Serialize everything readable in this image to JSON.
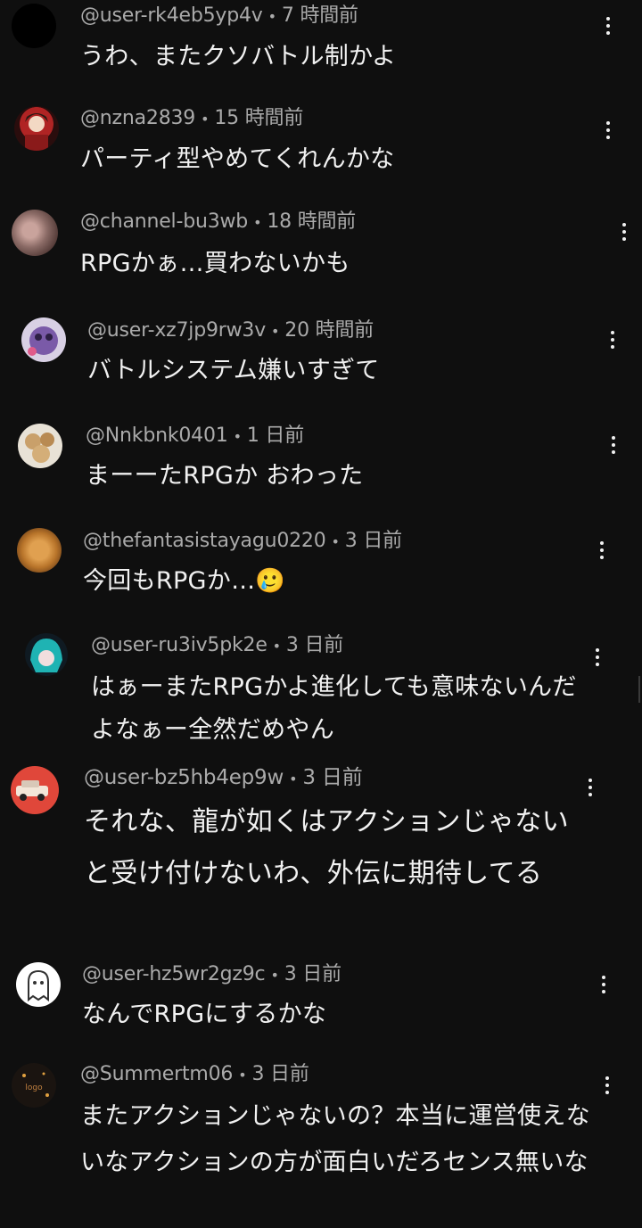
{
  "comments": [
    {
      "handle": "@user-rk4eb5yp4v",
      "time": "7 時間前",
      "text": "うわ、またクソバトル制かよ",
      "avatar": "black-circle-avatar",
      "avatar_color": "#000000"
    },
    {
      "handle": "@nzna2839",
      "time": "15 時間前",
      "text": "パーティ型やめてくれんかな",
      "avatar": "anime-character-avatar",
      "avatar_color": "#7a1f1f"
    },
    {
      "handle": "@channel-bu3wb",
      "time": "18 時間前",
      "text": "RPGかぁ…買わないかも",
      "avatar": "blurred-photo-avatar",
      "avatar_color": "#8b6b66"
    },
    {
      "handle": "@user-xz7jp9rw3v",
      "time": "20 時間前",
      "text": "バトルシステム嫌いすぎて",
      "avatar": "purple-character-avatar",
      "avatar_color": "#7a5aa8"
    },
    {
      "handle": "@Nnkbnk0401",
      "time": "1 日前",
      "text": "まーーたRPGか おわった",
      "avatar": "food-photo-avatar",
      "avatar_color": "#c9a06a"
    },
    {
      "handle": "@thefantasistayagu0220",
      "time": "3 日前",
      "text": "今回もRPGか…🥲",
      "avatar": "fried-food-avatar",
      "avatar_color": "#b8742a"
    },
    {
      "handle": "@user-ru3iv5pk2e",
      "time": "3 日前",
      "text": "はぁーまたRPGかよ進化しても意味ないんだよなぁー全然だめやん",
      "avatar": "teal-hair-character-avatar",
      "avatar_color": "#1fb3b3"
    },
    {
      "handle": "@user-bz5hb4ep9w",
      "time": "3 日前",
      "text": "それな、龍が如くはアクションじゃないと受け付けないわ、外伝に期待してる",
      "avatar": "red-car-avatar",
      "avatar_color": "#e0473a"
    },
    {
      "handle": "@user-hz5wr2gz9c",
      "time": "3 日前",
      "text": "なんでRPGにするかな",
      "avatar": "ghost-avatar",
      "avatar_color": "#ffffff"
    },
    {
      "handle": "@Summertm06",
      "time": "3 日前",
      "text": "またアクションじゃないの？本当に運営使えないなアクションの方が面白いだろセンス無いな",
      "avatar": "dark-logo-avatar",
      "avatar_color": "#1a1410"
    }
  ],
  "labels": {
    "more_actions": "more-vertical-icon",
    "separator": "•"
  }
}
